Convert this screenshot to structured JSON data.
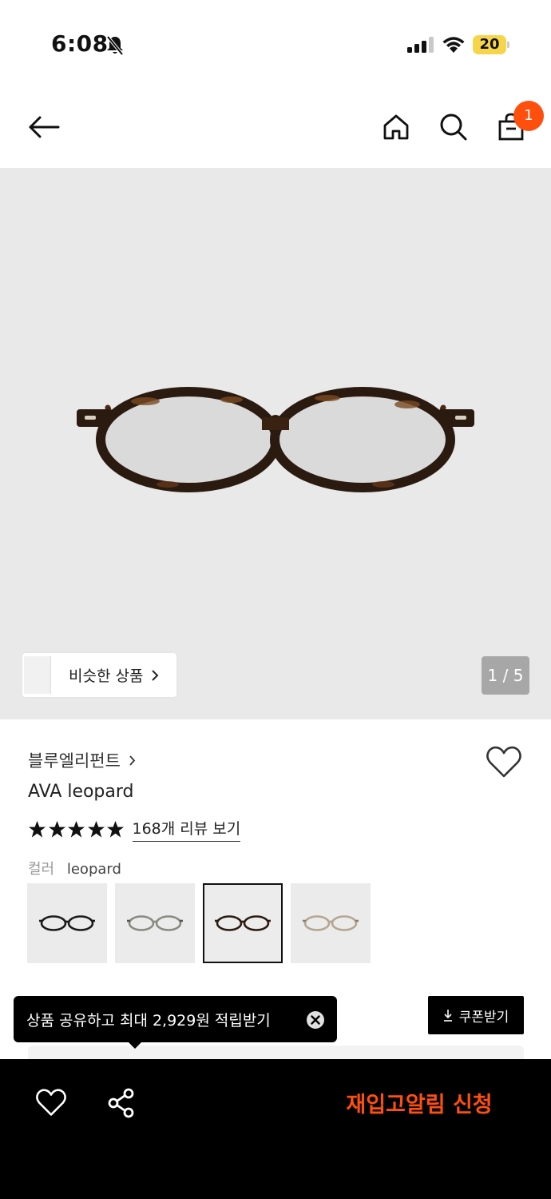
{
  "status_bar": {
    "time": "6:08",
    "battery": "20",
    "icons": [
      "bell-slash-icon",
      "cellular-signal-icon",
      "wifi-icon",
      "battery-icon"
    ]
  },
  "nav": {
    "icons": [
      "back-arrow-icon",
      "home-icon",
      "search-icon",
      "shopping-bag-icon"
    ],
    "cart_count": "1",
    "badge_color": "#ff4f0e"
  },
  "gallery": {
    "similar_label": "비슷한 상품",
    "page_indicator": "1 / 5",
    "background": "#e9e9e9"
  },
  "product": {
    "brand": "블루엘리펀트",
    "name": "AVA leopard",
    "rating": 5,
    "review_link": "168개 리뷰 보기",
    "color_label": "컬러",
    "color_value": "leopard",
    "swatch_count": 4,
    "selected_swatch": 3
  },
  "promo": {
    "share_tooltip": "상품 공유하고 최대 2,929원 적립받기",
    "coupon_button": "쿠폰받기"
  },
  "bottom_bar": {
    "restock_button": "재입고알림 신청",
    "accent": "#ff4f0e"
  }
}
